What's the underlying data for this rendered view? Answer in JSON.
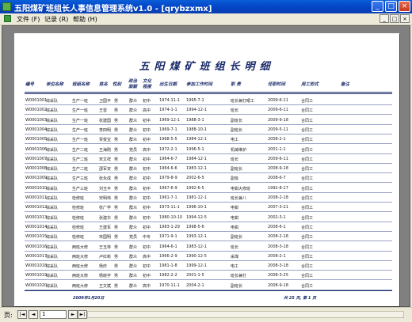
{
  "window": {
    "title": "五阳煤矿班组长人事信息管理系统v1.0 - [qrybzxmx]",
    "min": "_",
    "max": "□",
    "close": "×"
  },
  "menu": {
    "file": "文件 (F)",
    "record": "记录 (R)",
    "help": "帮助 (H)"
  },
  "report": {
    "title": "五阳煤矿班组长明细",
    "headers": {
      "id": "编号",
      "unit": "单位名称",
      "team": "班组名称",
      "name": "姓名",
      "sex": "性别",
      "pol1": "政治",
      "pol2": "面貌",
      "edu1": "文化",
      "edu2": "程度",
      "birth": "出生日期",
      "work": "参加工作时间",
      "post": "职 责",
      "entry": "任职时间",
      "emp": "用工形式",
      "note": "备注"
    },
    "rows": [
      [
        "W0001001",
        "综采队",
        "生产一班",
        "卫国平",
        "男",
        "群众",
        "初中",
        "1974-11-1",
        "1995-7-1",
        "班长兼打眼工",
        "2009-6-11",
        "合同工"
      ],
      [
        "W0001002",
        "综采队",
        "生产一班",
        "王雷",
        "男",
        "群众",
        "高中",
        "1974-1-1",
        "1994-12-1",
        "班长",
        "2009-6-11",
        "合同工"
      ],
      [
        "W0001003",
        "综采队",
        "生产一班",
        "张建国",
        "男",
        "群众",
        "初中",
        "1969-12-1",
        "1988-3-1",
        "副班长",
        "2009-9-18",
        "合同工"
      ],
      [
        "W0001004",
        "综采队",
        "生产一班",
        "李四明",
        "男",
        "群众",
        "初中",
        "1969-7-1",
        "1988-10-1",
        "副班长",
        "2009-5-11",
        "合同工"
      ],
      [
        "W0001005",
        "综采队",
        "生产一班",
        "贾俊宝",
        "男",
        "群众",
        "初中",
        "1968-5-5",
        "1984-12-1",
        "电工",
        "2008-2-1",
        "合同工"
      ],
      [
        "W0001006",
        "综采队",
        "生产二班",
        "王海刚",
        "男",
        "党员",
        "高中",
        "1972-2-1",
        "1996-5-1",
        "机械维护",
        "2001-1-1",
        "合同工"
      ],
      [
        "W0001007",
        "综采队",
        "生产二班",
        "宋文祥",
        "男",
        "群众",
        "初中",
        "1964-6-7",
        "1984-12-1",
        "班长",
        "2009-6-11",
        "合同工"
      ],
      [
        "W0001008",
        "综采队",
        "生产二班",
        "邵军安",
        "男",
        "群众",
        "初中",
        "1964-6-6",
        "1983-12-1",
        "副班长",
        "2008-9-18",
        "合同工"
      ],
      [
        "W0001009",
        "综采队",
        "生产三班",
        "张永成",
        "男",
        "群众",
        "初中",
        "1979-8-9",
        "2002-6-5",
        "副班",
        "2008-6-7",
        "合同工"
      ],
      [
        "W0001010",
        "综采队",
        "生产三班",
        "刘玉平",
        "男",
        "群众",
        "初中",
        "1967-6-9",
        "1992-6-5",
        "电钳大修班",
        "1992-8-17",
        "合同工"
      ],
      [
        "W0001011",
        "综采队",
        "检修班",
        "宋明伟",
        "男",
        "群众",
        "初中",
        "1961-7-1",
        "1981-12-1",
        "班长兼八",
        "2008-2-18",
        "合同工"
      ],
      [
        "W0001012",
        "综采队",
        "检修班",
        "张广学",
        "男",
        "群众",
        "初中",
        "1973-11-1",
        "1996-10-1",
        "电钳",
        "2007-3-21",
        "合同工"
      ],
      [
        "W0001013",
        "综采队",
        "检修班",
        "张建华",
        "男",
        "群众",
        "初中",
        "1980-10-10",
        "1994-12-5",
        "电钳",
        "2002-3-1",
        "合同工"
      ],
      [
        "W0001014",
        "综采队",
        "检修班",
        "王建军",
        "男",
        "群众",
        "初中",
        "1983-1-29",
        "1998-5-6",
        "电钳",
        "2008-6-1",
        "合同工"
      ],
      [
        "W0001015",
        "综采队",
        "检修班",
        "宋国明",
        "男",
        "党员",
        "中专",
        "1971-9-1",
        "1993-12-1",
        "副班长",
        "2008-2-18",
        "合同工"
      ],
      [
        "W0001016",
        "综采队",
        "两班大修",
        "王玉林",
        "男",
        "群众",
        "初中",
        "1964-6-1",
        "1983-12-1",
        "班长",
        "2008-3-18",
        "合同工"
      ],
      [
        "W0001017",
        "综采队",
        "两班大修",
        "卢红新",
        "男",
        "群众",
        "高中",
        "1966-2-9",
        "1990-12-5",
        "采煤",
        "2008-2-1",
        "合同工"
      ],
      [
        "W0001018",
        "综采队",
        "两班大修",
        "杨庆",
        "男",
        "群众",
        "初中",
        "1981-1-8",
        "1999-12-1",
        "电工",
        "2008-3-18",
        "合同工"
      ],
      [
        "W0001019",
        "综采队",
        "两班大修",
        "杨晓宇",
        "男",
        "群众",
        "初中",
        "1982-2-2",
        "2001-1-5",
        "班长兼打",
        "2008-3-25",
        "合同工"
      ],
      [
        "W0001020",
        "综采队",
        "两班大修",
        "王文斌",
        "男",
        "群众",
        "高中",
        "1970-11-1",
        "2004-2-1",
        "副班长",
        "2008-9-18",
        "合同工"
      ]
    ],
    "footer_date": "2009年1月20日",
    "footer_pages": "共 25 页, 第 1 页"
  },
  "status": {
    "label": "页:",
    "first": "|◄",
    "prev": "◄",
    "page": "1",
    "next": "►",
    "last": "►|"
  }
}
